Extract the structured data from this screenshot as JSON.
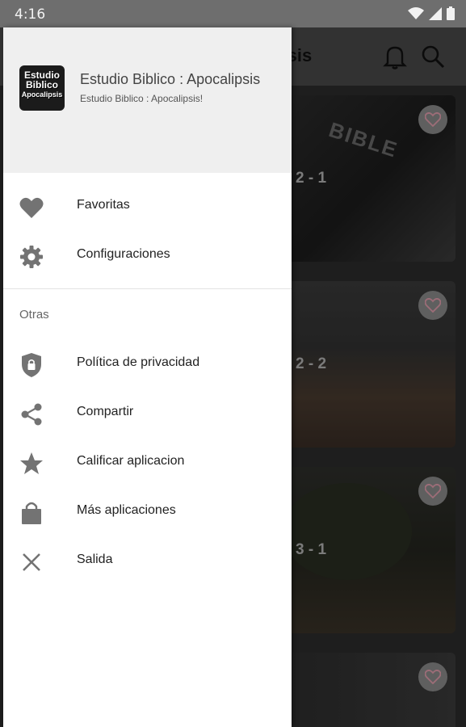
{
  "status_bar": {
    "time": "4:16"
  },
  "app": {
    "title_fragment": "lipsis",
    "cards": [
      {
        "label": "2 - 1",
        "cover_text": "BIBLE"
      },
      {
        "label": "2 - 2"
      },
      {
        "label": "3 - 1"
      },
      {
        "label": ""
      }
    ]
  },
  "drawer": {
    "logo_lines": [
      "Estudio",
      "Biblico",
      "Apocalipsis"
    ],
    "app_name": "Estudio Biblico : Apocalipsis",
    "app_subtitle": "Estudio Biblico : Apocalipsis!",
    "items": [
      {
        "label": "Favoritas",
        "icon": "heart-icon"
      },
      {
        "label": "Configuraciones",
        "icon": "gear-icon"
      }
    ],
    "section_label": "Otras",
    "other_items": [
      {
        "label": "Política de privacidad",
        "icon": "shield-lock-icon"
      },
      {
        "label": "Compartir",
        "icon": "share-icon"
      },
      {
        "label": "Calificar aplicacion",
        "icon": "star-icon"
      },
      {
        "label": "Más aplicaciones",
        "icon": "shopping-bag-icon"
      },
      {
        "label": "Salida",
        "icon": "close-icon"
      }
    ]
  },
  "colors": {
    "drawer_header_bg": "#efefef",
    "icon_gray": "#737373",
    "heart_pink": "#e7a1b1"
  }
}
